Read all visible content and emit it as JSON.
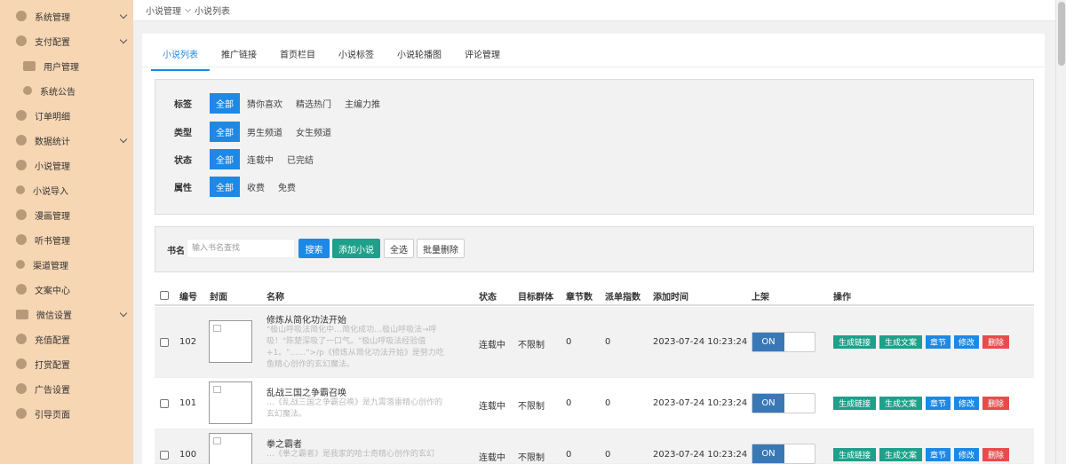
{
  "sidebar": {
    "items": [
      {
        "label": "系统管理",
        "icon": "gear-icon",
        "chevron": true
      },
      {
        "label": "支付配置",
        "icon": "coin-icon",
        "chevron": true
      },
      {
        "label": "用户管理",
        "icon": "id-card-icon",
        "chevron": false
      },
      {
        "label": "系统公告",
        "icon": "megaphone-icon",
        "chevron": false
      },
      {
        "label": "订单明细",
        "icon": "order-icon",
        "chevron": false
      },
      {
        "label": "数据统计",
        "icon": "chart-icon",
        "chevron": true
      },
      {
        "label": "小说管理",
        "icon": "book-icon",
        "chevron": false
      },
      {
        "label": "小说导入",
        "icon": "user-import-icon",
        "chevron": false
      },
      {
        "label": "漫画管理",
        "icon": "comic-icon",
        "chevron": false
      },
      {
        "label": "听书管理",
        "icon": "headphone-icon",
        "chevron": false
      },
      {
        "label": "渠道管理",
        "icon": "user-channel-icon",
        "chevron": false
      },
      {
        "label": "文案中心",
        "icon": "doc-icon",
        "chevron": false
      },
      {
        "label": "微信设置",
        "icon": "wechat-icon",
        "chevron": true
      },
      {
        "label": "充值配置",
        "icon": "recharge-icon",
        "chevron": false
      },
      {
        "label": "打赏配置",
        "icon": "reward-icon",
        "chevron": false
      },
      {
        "label": "广告设置",
        "icon": "ad-icon",
        "chevron": false
      },
      {
        "label": "引导页面",
        "icon": "guide-icon",
        "chevron": false
      }
    ]
  },
  "breadcrumb": {
    "parent": "小说管理",
    "current": "小说列表"
  },
  "tabs": [
    "小说列表",
    "推广链接",
    "首页栏目",
    "小说标签",
    "小说轮播图",
    "评论管理"
  ],
  "filters": [
    {
      "label": "标签",
      "options": [
        "全部",
        "猜你喜欢",
        "精选热门",
        "主编力推"
      ]
    },
    {
      "label": "类型",
      "options": [
        "全部",
        "男生频道",
        "女生频道"
      ]
    },
    {
      "label": "状态",
      "options": [
        "全部",
        "连载中",
        "已完结"
      ]
    },
    {
      "label": "属性",
      "options": [
        "全部",
        "收费",
        "免费"
      ]
    }
  ],
  "search": {
    "label": "书名",
    "placeholder": "输入书名查找",
    "search_btn": "搜索",
    "add_btn": "添加小说",
    "select_all_btn": "全选",
    "batch_delete_btn": "批量删除"
  },
  "table": {
    "headers": {
      "id": "编号",
      "cover": "封面",
      "name": "名称",
      "status": "状态",
      "target": "目标群体",
      "chapters": "章节数",
      "dispatch": "派单指数",
      "added": "添加时间",
      "shelf": "上架",
      "actions": "操作"
    },
    "toggle_on": "ON",
    "action_labels": {
      "link": "生成链接",
      "copy": "生成文案",
      "chapter": "章节",
      "edit": "修改",
      "delete": "删除"
    },
    "rows": [
      {
        "id": "102",
        "name": "修炼从简化功法开始",
        "desc": "\"极山呼吸法简化中…简化成功…极山呼吸法→呼吸！\"陈楚深吸了一口气。\"极山呼吸法经验值+1。\"……\">/p《修炼从简化功法开始》是努力吃鱼精心创作的玄幻魔法。",
        "status": "连载中",
        "target": "不限制",
        "chapters": "0",
        "dispatch": "0",
        "added": "2023-07-24 10:23:24"
      },
      {
        "id": "101",
        "name": "乱战三国之争霸召唤",
        "desc": "…《乱战三国之争霸召唤》是九霄落雷精心创作的玄幻魔法。",
        "status": "连载中",
        "target": "不限制",
        "chapters": "0",
        "dispatch": "0",
        "added": "2023-07-24 10:23:24"
      },
      {
        "id": "100",
        "name": "拳之霸者",
        "desc": "…《拳之霸者》是我家的哈士奇精心创作的玄幻",
        "status": "连载中",
        "target": "不限制",
        "chapters": "0",
        "dispatch": "0",
        "added": "2023-07-24 10:23:24"
      }
    ]
  },
  "colors": {
    "primary": "#1e88e5",
    "success": "#1ea08a",
    "danger": "#e74c4c",
    "sidebar_bg": "#f7d6b3",
    "toggle_on": "#3a78b5"
  }
}
